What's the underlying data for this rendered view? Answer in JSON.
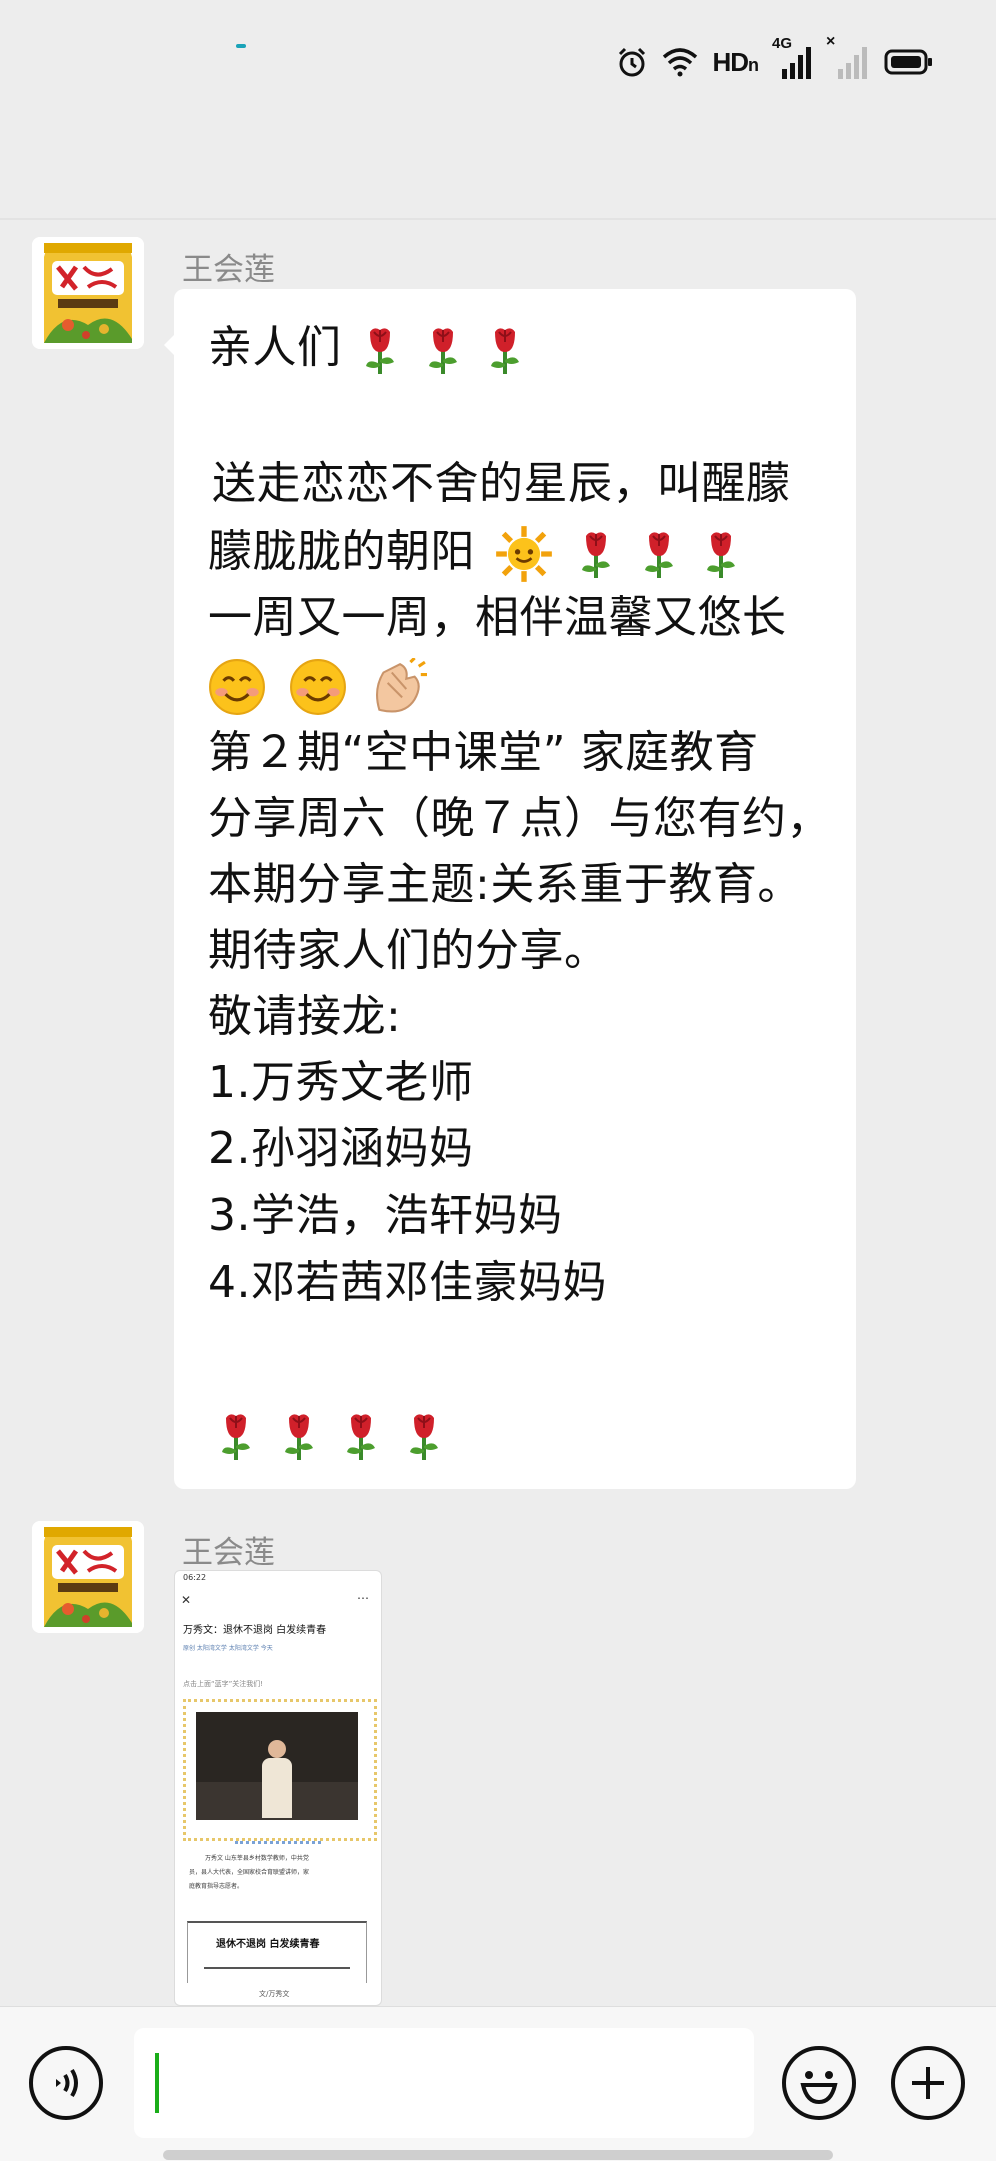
{
  "status_bar": {
    "network_label": "HD",
    "network_sub": "n",
    "network_gen": "4G",
    "sim2_mark": "×",
    "icons": [
      "alarm-icon",
      "wifi-icon",
      "signal-icon",
      "signal-empty-icon",
      "battery-icon"
    ]
  },
  "messages": [
    {
      "sender": "王会莲",
      "lines": [
        "亲人们",
        "",
        " 送走恋恋不舍的星辰，叫醒朦",
        "朦胧胧的朝阳",
        "一周又一周，相伴温馨又悠长",
        "",
        "第２期“空中课堂” 家庭教育",
        "分享周六（晚７点）与您有约，",
        "本期分享主题:关系重于教育。",
        "期待家人们的分享。",
        "敬请接龙:",
        "1.万秀文老师",
        "2.孙羽涵妈妈",
        "3.学浩，浩轩妈妈",
        "4.邓若茜邓佳豪妈妈"
      ],
      "emojis": [
        "rose",
        "sun",
        "smiling-face",
        "clapping-hands"
      ]
    },
    {
      "sender": "王会莲",
      "image_preview": {
        "time": "06:22",
        "title": "万秀文：退休不退岗 白发续青春",
        "meta": "原创  太阳湾文学  太阳湾文学  今天",
        "follow_hint": "点击上面“蓝字”关注我们!",
        "caption_line1": "万秀文  山东莘县乡村数学教师，中共党",
        "caption_line2": "员，县人大代表，全国家校合育联盟讲师，家",
        "caption_line3": "庭教育指导志愿者。",
        "article_heading": "退休不退岗  白发续青春",
        "byline": "文/万秀文"
      }
    }
  ],
  "input": {
    "value": "",
    "placeholder": ""
  },
  "colors": {
    "background": "#ededed",
    "bubble": "#ffffff",
    "accent_green": "#1aad19"
  }
}
